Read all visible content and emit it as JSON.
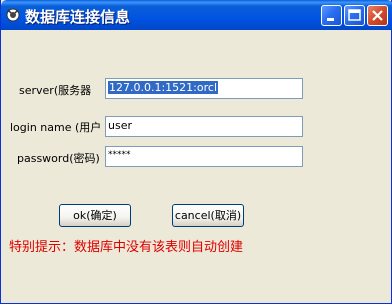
{
  "window": {
    "title": "数据库连接信息",
    "icon": "database-app-icon"
  },
  "form": {
    "server_label": "server(服务器",
    "server_value": "127.0.0.1:1521:orcl",
    "login_label": "login name (用户",
    "login_value": "user",
    "password_label": "password(密码)",
    "password_value": "*****"
  },
  "buttons": {
    "ok": "ok(确定)",
    "cancel": "cancel(取消)"
  },
  "hint": "特别提示：数据库中没有该表则自动创建",
  "colors": {
    "titlebar": "#0054e3",
    "hint": "#e00000",
    "selection": "#316ac5"
  }
}
